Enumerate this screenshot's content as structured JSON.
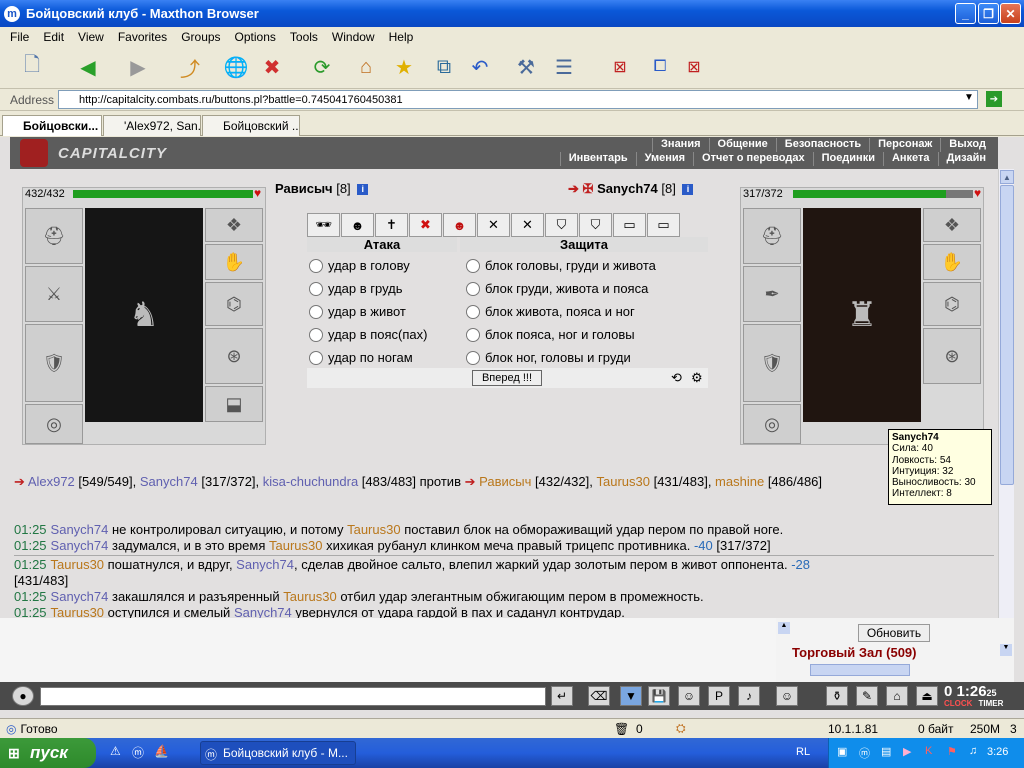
{
  "window": {
    "title": "Бойцовский клуб - Maxthon Browser"
  },
  "menu": [
    "File",
    "Edit",
    "View",
    "Favorites",
    "Groups",
    "Options",
    "Tools",
    "Window",
    "Help"
  ],
  "address": {
    "label": "Address",
    "url": "http://capitalcity.combats.ru/buttons.pl?battle=0.745041760450381"
  },
  "tabs": [
    "Бойцовски...",
    "'Alex972, San...",
    "Бойцовский ..."
  ],
  "game": {
    "logo": "CAPITALCITY",
    "nav_top": [
      "Знания",
      "Общение",
      "Безопасность",
      "Персонаж",
      "Выход"
    ],
    "nav_bottom": [
      "Инвентарь",
      "Умения",
      "Отчет о переводах",
      "Поединки",
      "Анкета",
      "Дизайн"
    ]
  },
  "left_player": {
    "hp": "432/432",
    "hp_fraction": 1.0,
    "name": "Рависыч",
    "level": "[8]"
  },
  "right_player": {
    "hp": "317/372",
    "hp_fraction": 0.85,
    "name": "Sanych74",
    "level": "[8]"
  },
  "combat": {
    "attack_header": "Атака",
    "defense_header": "Защита",
    "attacks": [
      "удар в голову",
      "удар в грудь",
      "удар в живот",
      "удар в пояс(пах)",
      "удар по ногам"
    ],
    "blocks": [
      "блок головы, груди и живота",
      "блок груди, живота и пояса",
      "блок живота, пояса и ног",
      "блок пояса, ног и головы",
      "блок ног, головы и груди"
    ],
    "forward_button": "Вперед !!!"
  },
  "tooltip": {
    "name": "Sanych74",
    "stats": [
      "Сила: 40",
      "Ловкость: 54",
      "Интуиция: 32",
      "Выносливость: 30",
      "Интеллект: 8"
    ]
  },
  "versus": {
    "team1": [
      {
        "name": "Alex972",
        "hp": "[549/549]"
      },
      {
        "name": "Sanych74",
        "hp": "[317/372]"
      },
      {
        "name": "kisa-chuchundra",
        "hp": "[483/483]"
      }
    ],
    "vs_word": "против",
    "team2": [
      {
        "name": "Рависыч",
        "hp": "[432/432]"
      },
      {
        "name": "Taurus30",
        "hp": "[431/483]"
      },
      {
        "name": "mashine",
        "hp": "[486/486]"
      }
    ]
  },
  "log": [
    {
      "time": "01:25",
      "p1": "Sanych74",
      "p1c": "blue",
      "t1": " не контролировал ситуацию, и потому ",
      "p2": "Taurus30",
      "p2c": "orange",
      "t2": " поставил блок на обмораживащий удар пером по правой ноге.",
      "dmg": "",
      "rest": ""
    },
    {
      "time": "01:25",
      "p1": "Sanych74",
      "p1c": "blue",
      "t1": " задумался, и в это время ",
      "p2": "Taurus30",
      "p2c": "orange",
      "t2": " хихикая рубанул клинком меча правый трицепс противника. ",
      "dmg": "-40",
      "rest": " [317/372]"
    },
    {
      "time": "01:25",
      "p1": "Taurus30",
      "p1c": "orange",
      "t1": " пошатнулся, и вдруг, ",
      "p2": "Sanych74",
      "p2c": "blue",
      "t2": ", сделав двойное сальто, влепил жаркий удар золотым пером в живот оппонента. ",
      "dmg": "-28",
      "rest": ""
    },
    {
      "time": "",
      "p1": "",
      "p1c": "",
      "t1": "[431/483]",
      "p2": "",
      "p2c": "",
      "t2": "",
      "dmg": "",
      "rest": ""
    },
    {
      "time": "01:25",
      "p1": "Sanych74",
      "p1c": "blue",
      "t1": " закашлялся и разъяренный ",
      "p2": "Taurus30",
      "p2c": "orange",
      "t2": " отбил удар элегантным обжигающим пером в промежность.",
      "dmg": "",
      "rest": ""
    },
    {
      "time": "01:25",
      "p1": "Taurus30",
      "p1c": "orange",
      "t1": " оступился и смелый ",
      "p2": "Sanych74",
      "p2c": "blue",
      "t2": " увернулся от удара гардой в пах и саданул контрудар.",
      "dmg": "",
      "rest": ""
    }
  ],
  "market": {
    "refresh": "Обновить",
    "title": "Торговый Зал (509)"
  },
  "clock": {
    "time": "0 1:26",
    "sec": "25",
    "clock_label": "CLOCK",
    "timer_label": "TIMER"
  },
  "status": {
    "text": "Готово",
    "count": "0",
    "ip": "10.1.1.81",
    "bytes": "0 байт",
    "mem": "250M",
    "num": "3"
  },
  "taskbar": {
    "start": "пуск",
    "item": "Бойцовский клуб - M...",
    "lang": "RL",
    "time": "3:26"
  }
}
